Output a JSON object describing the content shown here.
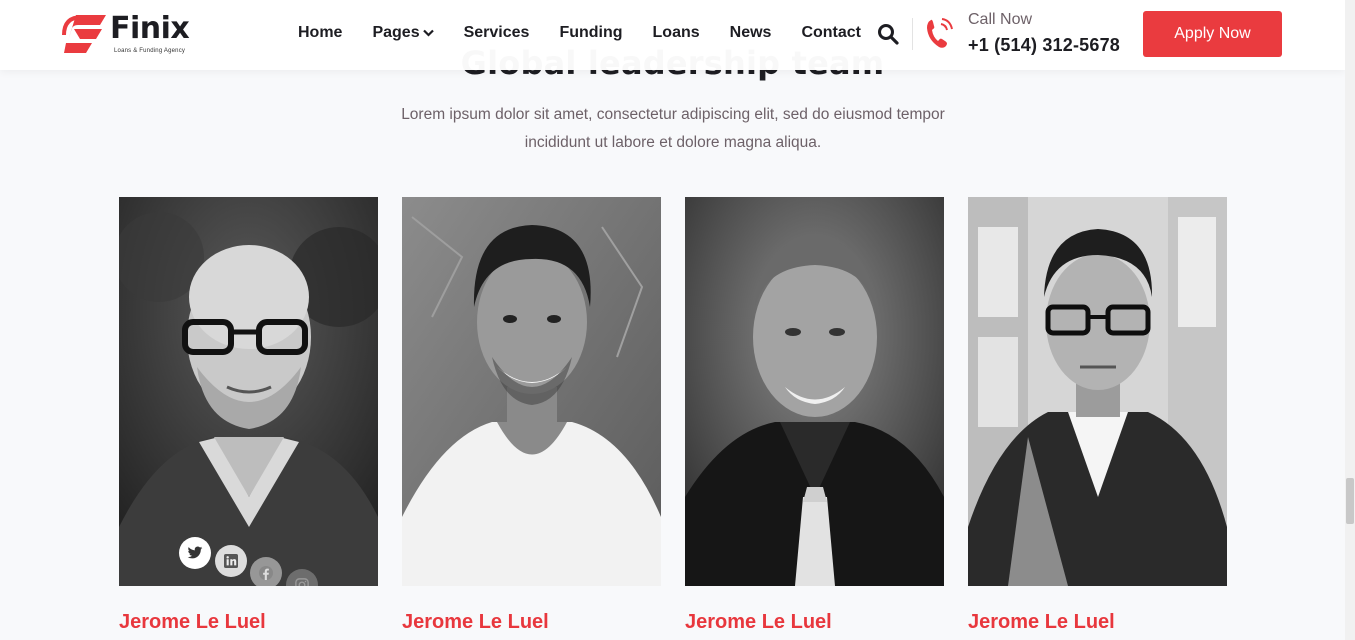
{
  "brand": {
    "name": "Finix",
    "tagline": "Loans & Funding Agency",
    "accent_color": "#ea3b3f"
  },
  "nav": {
    "items": [
      {
        "label": "Home"
      },
      {
        "label": "Pages",
        "has_dropdown": true
      },
      {
        "label": "Services"
      },
      {
        "label": "Funding"
      },
      {
        "label": "Loans"
      },
      {
        "label": "News"
      },
      {
        "label": "Contact"
      }
    ]
  },
  "header": {
    "search_icon": "search-icon",
    "call_label": "Call Now",
    "call_number": "+1 (514) 312-5678",
    "apply_label": "Apply Now"
  },
  "section": {
    "title": "Global leadership team",
    "description": "Lorem ipsum dolor sit amet, consectetur adipiscing elit, sed do eiusmod tempor incididunt ut labore et dolore magna aliqua."
  },
  "team": [
    {
      "name": "Jerome Le Luel",
      "socials": [
        "twitter-icon",
        "linkedin-icon",
        "facebook-icon",
        "instagram-icon"
      ]
    },
    {
      "name": "Jerome Le Luel"
    },
    {
      "name": "Jerome Le Luel"
    },
    {
      "name": "Jerome Le Luel"
    }
  ]
}
